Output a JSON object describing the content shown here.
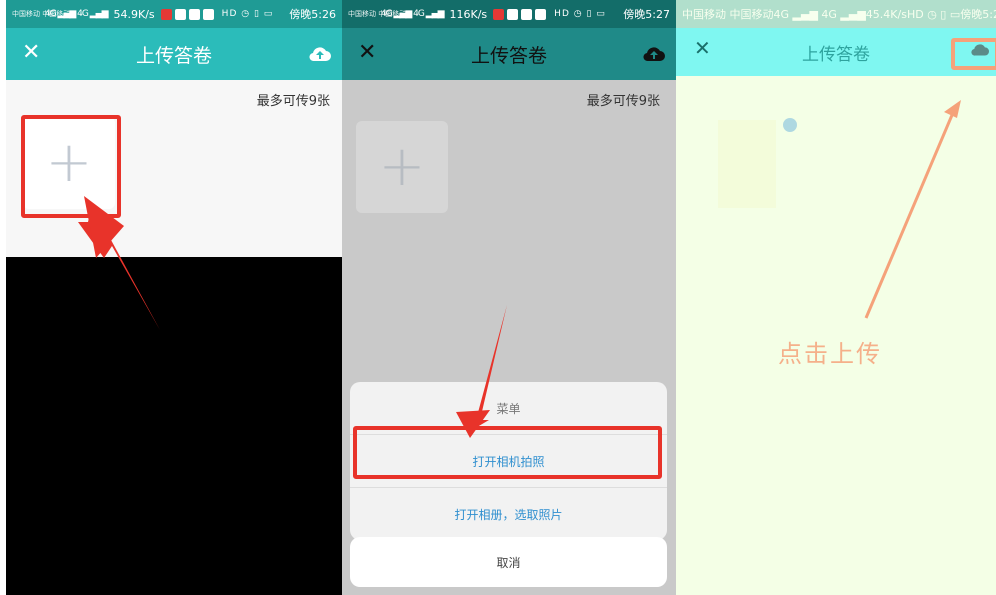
{
  "screens": [
    {
      "status": {
        "carrier": "中国移动\n中国移动",
        "signal": "4G ▂▄▆ 4G ▂▄▆",
        "speed": "54.9K/s",
        "system": "HD ◷ ▯ ▭",
        "time": "傍晚5:26"
      },
      "nav": {
        "close": "✕",
        "title": "上传答卷",
        "upload_icon": "cloud-upload-icon"
      },
      "max_note": "最多可传9张",
      "add_tile": {
        "symbol": "+"
      }
    },
    {
      "status": {
        "carrier": "中国移动\n中国移动",
        "signal": "4G ▂▄▆ 4G ▂▄▆",
        "speed": "116K/s",
        "system": "HD ◷ ▯ ▭",
        "time": "傍晚5:27"
      },
      "nav": {
        "close": "✕",
        "title": "上传答卷",
        "upload_icon": "cloud-upload-icon"
      },
      "max_note": "最多可传9张",
      "add_tile": {
        "symbol": "+"
      },
      "sheet": {
        "title": "菜单",
        "options": [
          "打开相机拍照",
          "打开相册，选取照片"
        ],
        "cancel": "取消"
      }
    },
    {
      "status": {
        "carrier": "中国移动\n中国移动",
        "signal": "4G ▂▄▆ 4G ▂▄▆",
        "speed": "45.4K/s",
        "system": "HD ◷ ▯ ▭",
        "time": "傍晚5:27"
      },
      "nav": {
        "close": "✕",
        "title": "上传答卷",
        "upload_icon": "cloud-upload-icon"
      },
      "callout": "点击上传"
    }
  ],
  "colors": {
    "teal": "#2bbcba",
    "status_teal": "#1f9b95",
    "red_annotation": "#e8332a",
    "link_blue": "#2f8fcf"
  }
}
